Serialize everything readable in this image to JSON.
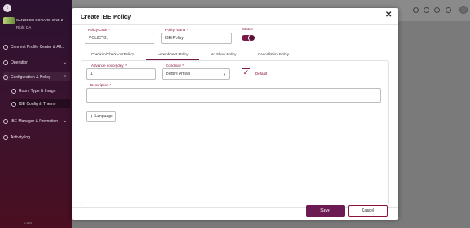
{
  "sidebar": {
    "hotel_name": "SANDBOX SORARD ONE 2",
    "hotel_sub": "Right QA",
    "items": [
      {
        "label": "Connect Profile Center & All..."
      },
      {
        "label": "Operation"
      },
      {
        "label": "Configuration & Policy"
      },
      {
        "label": "Room Type & Image"
      },
      {
        "label": "IBE Config & Theme"
      },
      {
        "label": "IBE Manager & Promotion"
      },
      {
        "label": "Activity log"
      }
    ],
    "footer": "v 1.0.0"
  },
  "modal": {
    "title": "Create IBE Policy",
    "policy_code_label": "Policy Code *",
    "policy_code_value": "POLICY01",
    "policy_name_label": "Policy Name *",
    "policy_name_value": "IBE Policy",
    "status_label": "Status",
    "status_on": true,
    "tabs": [
      {
        "label": "Check-in/Check-out Policy"
      },
      {
        "label": "Amendment Policy"
      },
      {
        "label": "No Show Policy"
      },
      {
        "label": "Cancellation Policy"
      }
    ],
    "active_tab": "Amendment Policy",
    "advance_label": "Advance notice(day) *",
    "advance_value": "1",
    "condition_label": "Condition *",
    "condition_value": "Before Arrival",
    "default_label": "Default",
    "default_checked": true,
    "description_label": "Description *",
    "description_value": "",
    "language_button": "Language",
    "save_label": "Save",
    "cancel_label": "Cancel"
  },
  "colors": {
    "accent": "#7a1a4a",
    "label": "#8a1539"
  }
}
